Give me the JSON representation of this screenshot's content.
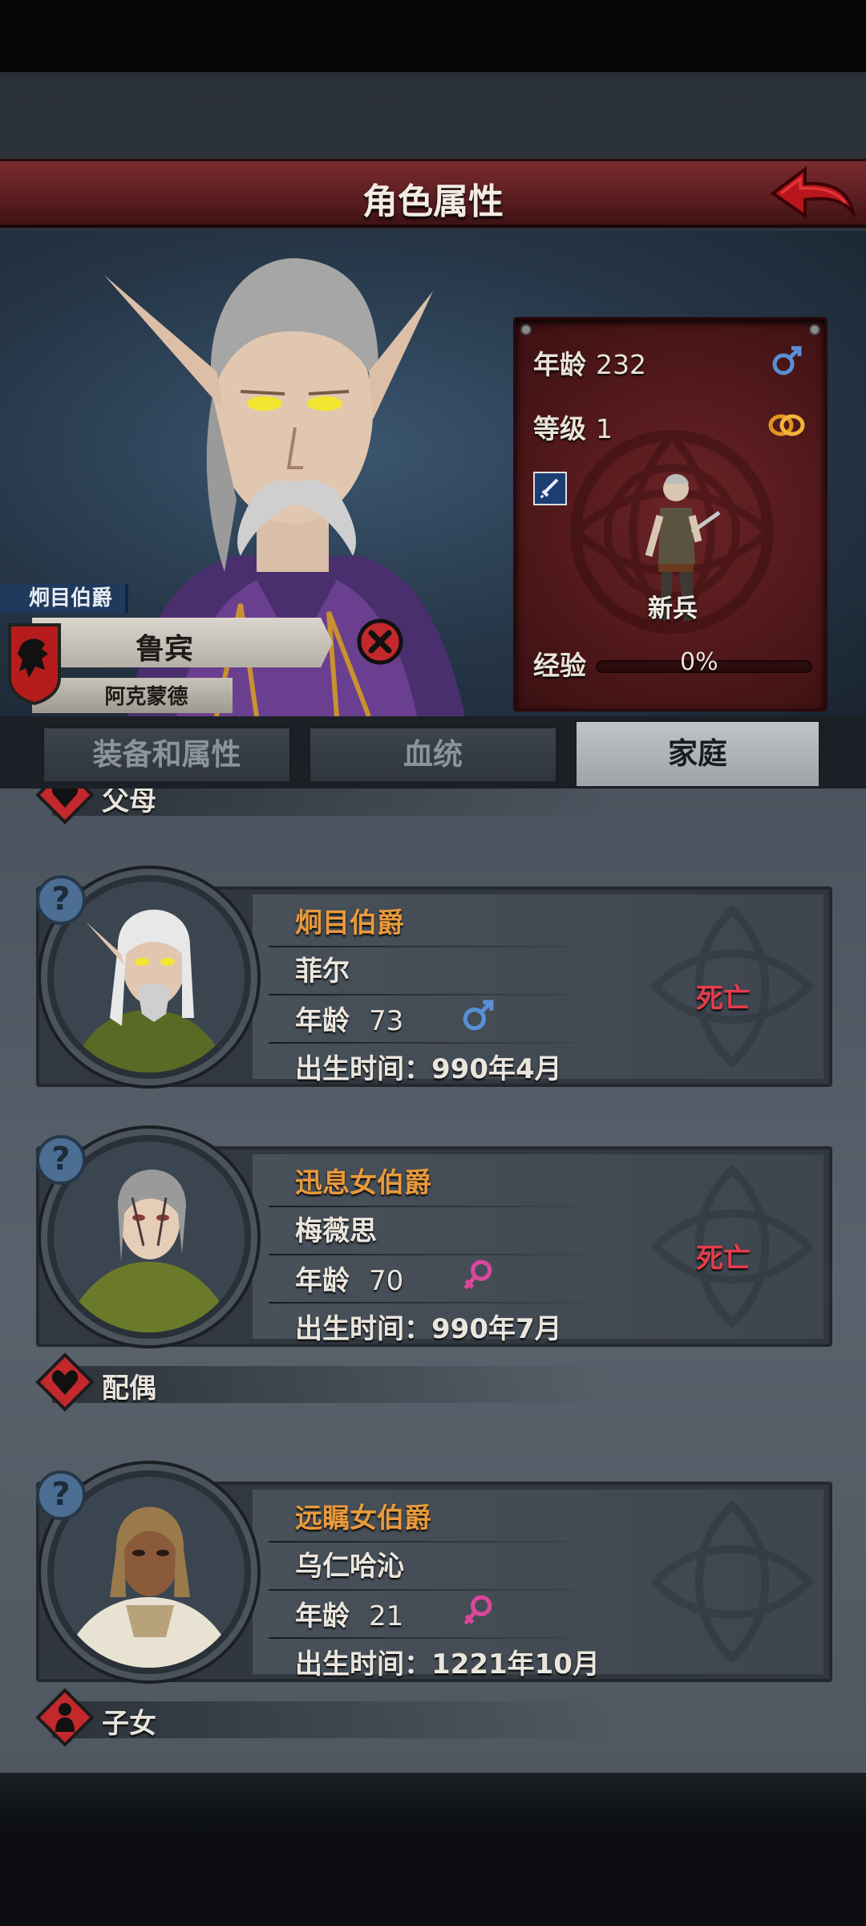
{
  "header": {
    "title": "角色属性"
  },
  "character": {
    "title_tag": "炯目伯爵",
    "name": "鲁宾",
    "house": "阿克蒙德",
    "age_label": "年龄",
    "age": "232",
    "level_label": "等级",
    "level": "1",
    "rank": "新兵",
    "exp_label": "经验",
    "exp": "0%",
    "exp_fraction": 0,
    "gender_icon": "male-icon",
    "marital_icon": "married-rings-icon"
  },
  "tabs": [
    {
      "label": "装备和属性",
      "active": false
    },
    {
      "label": "血统",
      "active": false
    },
    {
      "label": "家庭",
      "active": true
    }
  ],
  "sections": {
    "parents": "父母",
    "spouse": "配偶",
    "children": "子女"
  },
  "parents": [
    {
      "title": "炯目伯爵",
      "name": "菲尔",
      "age_label": "年龄",
      "age": "73",
      "gender": "male",
      "birth": "出生时间：990年4月",
      "status": "死亡"
    },
    {
      "title": "迅息女伯爵",
      "name": "梅薇思",
      "age_label": "年龄",
      "age": "70",
      "gender": "female",
      "birth": "出生时间：990年7月",
      "status": "死亡"
    }
  ],
  "spouse": [
    {
      "title": "远瞩女伯爵",
      "name": "乌仁哈沁",
      "age_label": "年龄",
      "age": "21",
      "gender": "female",
      "birth": "出生时间：1221年10月",
      "status": ""
    }
  ],
  "colors": {
    "banner": "#5a1d20",
    "title_orange": "#e89a3c",
    "dead_red": "#e53d4d",
    "male_blue": "#5a8fd6",
    "female_pink": "#d9479a"
  }
}
